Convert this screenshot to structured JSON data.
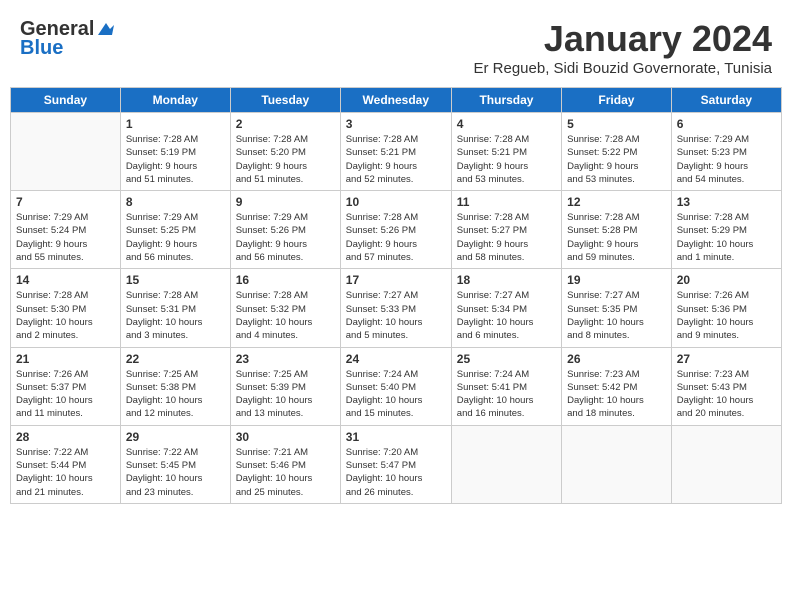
{
  "header": {
    "logo_general": "General",
    "logo_blue": "Blue",
    "month": "January 2024",
    "location": "Er Regueb, Sidi Bouzid Governorate, Tunisia"
  },
  "weekdays": [
    "Sunday",
    "Monday",
    "Tuesday",
    "Wednesday",
    "Thursday",
    "Friday",
    "Saturday"
  ],
  "weeks": [
    [
      {
        "day": "",
        "info": ""
      },
      {
        "day": "1",
        "info": "Sunrise: 7:28 AM\nSunset: 5:19 PM\nDaylight: 9 hours\nand 51 minutes."
      },
      {
        "day": "2",
        "info": "Sunrise: 7:28 AM\nSunset: 5:20 PM\nDaylight: 9 hours\nand 51 minutes."
      },
      {
        "day": "3",
        "info": "Sunrise: 7:28 AM\nSunset: 5:21 PM\nDaylight: 9 hours\nand 52 minutes."
      },
      {
        "day": "4",
        "info": "Sunrise: 7:28 AM\nSunset: 5:21 PM\nDaylight: 9 hours\nand 53 minutes."
      },
      {
        "day": "5",
        "info": "Sunrise: 7:28 AM\nSunset: 5:22 PM\nDaylight: 9 hours\nand 53 minutes."
      },
      {
        "day": "6",
        "info": "Sunrise: 7:29 AM\nSunset: 5:23 PM\nDaylight: 9 hours\nand 54 minutes."
      }
    ],
    [
      {
        "day": "7",
        "info": "Sunrise: 7:29 AM\nSunset: 5:24 PM\nDaylight: 9 hours\nand 55 minutes."
      },
      {
        "day": "8",
        "info": "Sunrise: 7:29 AM\nSunset: 5:25 PM\nDaylight: 9 hours\nand 56 minutes."
      },
      {
        "day": "9",
        "info": "Sunrise: 7:29 AM\nSunset: 5:26 PM\nDaylight: 9 hours\nand 56 minutes."
      },
      {
        "day": "10",
        "info": "Sunrise: 7:28 AM\nSunset: 5:26 PM\nDaylight: 9 hours\nand 57 minutes."
      },
      {
        "day": "11",
        "info": "Sunrise: 7:28 AM\nSunset: 5:27 PM\nDaylight: 9 hours\nand 58 minutes."
      },
      {
        "day": "12",
        "info": "Sunrise: 7:28 AM\nSunset: 5:28 PM\nDaylight: 9 hours\nand 59 minutes."
      },
      {
        "day": "13",
        "info": "Sunrise: 7:28 AM\nSunset: 5:29 PM\nDaylight: 10 hours\nand 1 minute."
      }
    ],
    [
      {
        "day": "14",
        "info": "Sunrise: 7:28 AM\nSunset: 5:30 PM\nDaylight: 10 hours\nand 2 minutes."
      },
      {
        "day": "15",
        "info": "Sunrise: 7:28 AM\nSunset: 5:31 PM\nDaylight: 10 hours\nand 3 minutes."
      },
      {
        "day": "16",
        "info": "Sunrise: 7:28 AM\nSunset: 5:32 PM\nDaylight: 10 hours\nand 4 minutes."
      },
      {
        "day": "17",
        "info": "Sunrise: 7:27 AM\nSunset: 5:33 PM\nDaylight: 10 hours\nand 5 minutes."
      },
      {
        "day": "18",
        "info": "Sunrise: 7:27 AM\nSunset: 5:34 PM\nDaylight: 10 hours\nand 6 minutes."
      },
      {
        "day": "19",
        "info": "Sunrise: 7:27 AM\nSunset: 5:35 PM\nDaylight: 10 hours\nand 8 minutes."
      },
      {
        "day": "20",
        "info": "Sunrise: 7:26 AM\nSunset: 5:36 PM\nDaylight: 10 hours\nand 9 minutes."
      }
    ],
    [
      {
        "day": "21",
        "info": "Sunrise: 7:26 AM\nSunset: 5:37 PM\nDaylight: 10 hours\nand 11 minutes."
      },
      {
        "day": "22",
        "info": "Sunrise: 7:25 AM\nSunset: 5:38 PM\nDaylight: 10 hours\nand 12 minutes."
      },
      {
        "day": "23",
        "info": "Sunrise: 7:25 AM\nSunset: 5:39 PM\nDaylight: 10 hours\nand 13 minutes."
      },
      {
        "day": "24",
        "info": "Sunrise: 7:24 AM\nSunset: 5:40 PM\nDaylight: 10 hours\nand 15 minutes."
      },
      {
        "day": "25",
        "info": "Sunrise: 7:24 AM\nSunset: 5:41 PM\nDaylight: 10 hours\nand 16 minutes."
      },
      {
        "day": "26",
        "info": "Sunrise: 7:23 AM\nSunset: 5:42 PM\nDaylight: 10 hours\nand 18 minutes."
      },
      {
        "day": "27",
        "info": "Sunrise: 7:23 AM\nSunset: 5:43 PM\nDaylight: 10 hours\nand 20 minutes."
      }
    ],
    [
      {
        "day": "28",
        "info": "Sunrise: 7:22 AM\nSunset: 5:44 PM\nDaylight: 10 hours\nand 21 minutes."
      },
      {
        "day": "29",
        "info": "Sunrise: 7:22 AM\nSunset: 5:45 PM\nDaylight: 10 hours\nand 23 minutes."
      },
      {
        "day": "30",
        "info": "Sunrise: 7:21 AM\nSunset: 5:46 PM\nDaylight: 10 hours\nand 25 minutes."
      },
      {
        "day": "31",
        "info": "Sunrise: 7:20 AM\nSunset: 5:47 PM\nDaylight: 10 hours\nand 26 minutes."
      },
      {
        "day": "",
        "info": ""
      },
      {
        "day": "",
        "info": ""
      },
      {
        "day": "",
        "info": ""
      }
    ]
  ]
}
